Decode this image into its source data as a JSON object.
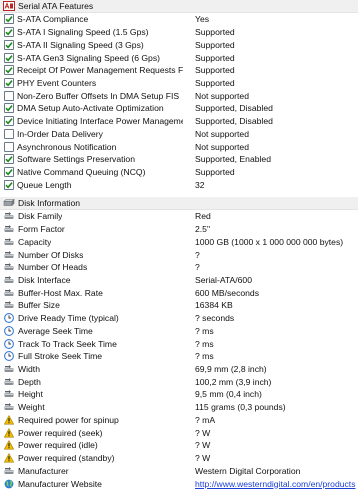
{
  "sections": {
    "sata": {
      "title": "Serial ATA Features",
      "icon": "sata-icon",
      "rows": [
        {
          "label": "S-ATA Compliance",
          "value": "Yes",
          "checked": true
        },
        {
          "label": "S-ATA I Signaling Speed (1.5 Gps)",
          "value": "Supported",
          "checked": true
        },
        {
          "label": "S-ATA II Signaling Speed (3 Gps)",
          "value": "Supported",
          "checked": true
        },
        {
          "label": "S-ATA Gen3 Signaling Speed (6 Gps)",
          "value": "Supported",
          "checked": true
        },
        {
          "label": "Receipt Of Power Management Requests Fro...",
          "value": "Supported",
          "checked": true
        },
        {
          "label": "PHY Event Counters",
          "value": "Supported",
          "checked": true
        },
        {
          "label": "Non-Zero Buffer Offsets In DMA Setup FIS",
          "value": "Not supported",
          "checked": false
        },
        {
          "label": "DMA Setup Auto-Activate Optimization",
          "value": "Supported, Disabled",
          "checked": true
        },
        {
          "label": "Device Initiating Interface Power Management",
          "value": "Supported, Disabled",
          "checked": true
        },
        {
          "label": "In-Order Data Delivery",
          "value": "Not supported",
          "checked": false
        },
        {
          "label": "Asynchronous Notification",
          "value": "Not supported",
          "checked": false
        },
        {
          "label": "Software Settings Preservation",
          "value": "Supported, Enabled",
          "checked": true
        },
        {
          "label": "Native Command Queuing (NCQ)",
          "value": "Supported",
          "checked": true
        },
        {
          "label": "Queue Length",
          "value": "32",
          "checked": true
        }
      ]
    },
    "disk": {
      "title": "Disk Information",
      "icon": "hard-disk-icon",
      "rows": [
        {
          "label": "Disk Family",
          "value": "Red",
          "icon": "disk-arrow-icon"
        },
        {
          "label": "Form Factor",
          "value": "2.5\"",
          "icon": "disk-arrow-icon"
        },
        {
          "label": "Capacity",
          "value": "1000 GB (1000 x 1 000 000 000 bytes)",
          "icon": "disk-arrow-icon"
        },
        {
          "label": "Number Of Disks",
          "value": "?",
          "icon": "disk-arrow-icon"
        },
        {
          "label": "Number Of Heads",
          "value": "?",
          "icon": "disk-arrow-icon"
        },
        {
          "label": "Disk Interface",
          "value": "Serial-ATA/600",
          "icon": "disk-arrow-icon"
        },
        {
          "label": "Buffer-Host Max. Rate",
          "value": "600 MB/seconds",
          "icon": "disk-arrow-icon"
        },
        {
          "label": "Buffer Size",
          "value": "16384 KB",
          "icon": "disk-arrow-icon"
        },
        {
          "label": "Drive Ready Time (typical)",
          "value": "? seconds",
          "icon": "clock-icon"
        },
        {
          "label": "Average Seek Time",
          "value": "? ms",
          "icon": "clock-icon"
        },
        {
          "label": "Track To Track Seek Time",
          "value": "? ms",
          "icon": "clock-icon"
        },
        {
          "label": "Full Stroke Seek Time",
          "value": "? ms",
          "icon": "clock-icon"
        },
        {
          "label": "Width",
          "value": "69,9 mm (2,8 inch)",
          "icon": "disk-arrow-icon"
        },
        {
          "label": "Depth",
          "value": "100,2 mm (3,9 inch)",
          "icon": "disk-arrow-icon"
        },
        {
          "label": "Height",
          "value": "9,5 mm (0,4 inch)",
          "icon": "disk-arrow-icon"
        },
        {
          "label": "Weight",
          "value": "115 grams (0,3 pounds)",
          "icon": "disk-arrow-icon"
        },
        {
          "label": "Required power for spinup",
          "value": "? mA",
          "icon": "warning-icon"
        },
        {
          "label": "Power required (seek)",
          "value": "? W",
          "icon": "warning-icon"
        },
        {
          "label": "Power required (idle)",
          "value": "? W",
          "icon": "warning-icon"
        },
        {
          "label": "Power required (standby)",
          "value": "? W",
          "icon": "warning-icon"
        },
        {
          "label": "Manufacturer",
          "value": "Western Digital Corporation",
          "icon": "disk-arrow-icon"
        },
        {
          "label": "Manufacturer Website",
          "value": "http://www.westerndigital.com/en/products",
          "icon": "globe-icon",
          "link": true
        }
      ]
    }
  },
  "colors": {
    "check": "#1b8a1b",
    "link": "#1a3fd6",
    "warning": "#f2c200",
    "clock": "#3a7bd5",
    "globe": "#2f7fd1"
  }
}
